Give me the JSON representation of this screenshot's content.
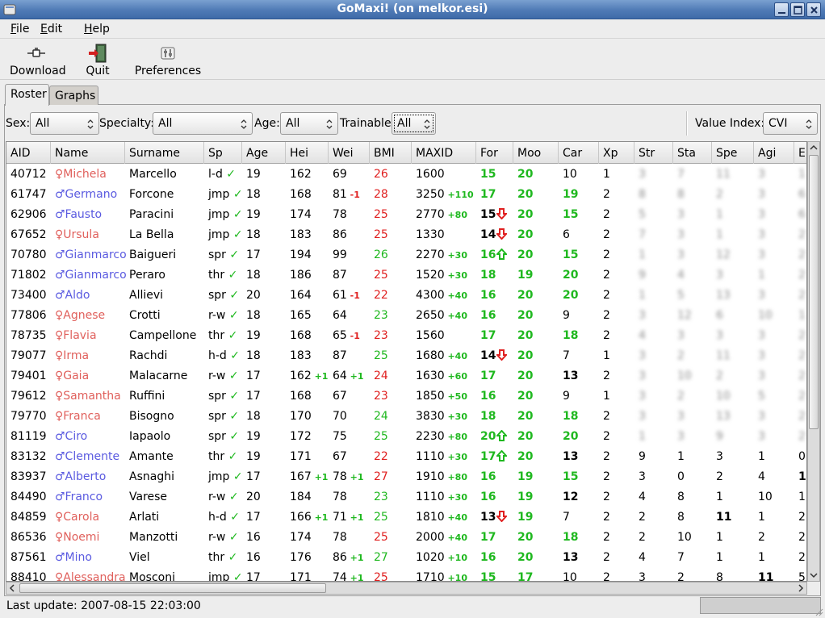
{
  "window": {
    "title": "GoMaxi! (on melkor.esi)"
  },
  "menus": [
    {
      "label": "File",
      "mnemonic": "F",
      "rest": "ile"
    },
    {
      "label": "Edit",
      "mnemonic": "E",
      "rest": "dit"
    },
    {
      "label": "Help",
      "mnemonic": "H",
      "rest": "elp"
    }
  ],
  "toolbar": {
    "download": "Download",
    "quit": "Quit",
    "preferences": "Preferences"
  },
  "tabs": [
    {
      "label": "Roster",
      "active": true
    },
    {
      "label": "Graphs",
      "active": false
    }
  ],
  "filters": {
    "sex": {
      "label": "Sex:",
      "value": "All"
    },
    "specialty": {
      "label": "Specialty:",
      "value": "All"
    },
    "age": {
      "label": "Age:",
      "value": "All"
    },
    "trainable": {
      "label": "Trainable:",
      "value": "All"
    },
    "value_index": {
      "label": "Value Index:",
      "value": "CVI"
    }
  },
  "columns": [
    "AID",
    "Name",
    "Surname",
    "Sp",
    "Age",
    "Hei",
    "Wei",
    "BMI",
    "MAXID",
    "For",
    "Moo",
    "Car",
    "Xp",
    "Str",
    "Sta",
    "Spe",
    "Agi",
    "E"
  ],
  "rows": [
    {
      "aid": "40712",
      "g": "f",
      "name": "Michela",
      "surname": "Marcello",
      "sp": "l-d",
      "age": "19",
      "hei": "162",
      "heid": "",
      "wei": "69",
      "weid": "",
      "bmi": "26",
      "bmic": "red",
      "maxid": "1600",
      "maxd": "",
      "for": "15",
      "fora": "",
      "moo": "20",
      "car": "10",
      "carc": "",
      "xp": "1",
      "str": "3",
      "sta": "7",
      "spe": "11",
      "agi": "3",
      "e": "1",
      "blur": true
    },
    {
      "aid": "61747",
      "g": "m",
      "name": "Germano",
      "surname": "Forcone",
      "sp": "jmp",
      "age": "18",
      "hei": "168",
      "heid": "",
      "wei": "81",
      "weid": "-1",
      "bmi": "28",
      "bmic": "red",
      "maxid": "3250",
      "maxd": "+110",
      "for": "17",
      "fora": "",
      "moo": "20",
      "car": "19",
      "carc": "g",
      "xp": "2",
      "str": "8",
      "sta": "8",
      "spe": "2",
      "agi": "3",
      "e": "6",
      "blur": true
    },
    {
      "aid": "62906",
      "g": "m",
      "name": "Fausto",
      "surname": "Paracini",
      "sp": "jmp",
      "age": "19",
      "hei": "174",
      "heid": "",
      "wei": "78",
      "weid": "",
      "bmi": "25",
      "bmic": "red",
      "maxid": "2770",
      "maxd": "+80",
      "for": "15",
      "fora": "down",
      "moo": "20",
      "car": "15",
      "carc": "g",
      "xp": "2",
      "str": "5",
      "sta": "3",
      "spe": "1",
      "agi": "3",
      "e": "6",
      "blur": true
    },
    {
      "aid": "67652",
      "g": "f",
      "name": "Ursula",
      "surname": "La Bella",
      "sp": "jmp",
      "age": "18",
      "hei": "183",
      "heid": "",
      "wei": "86",
      "weid": "",
      "bmi": "25",
      "bmic": "red",
      "maxid": "1330",
      "maxd": "",
      "for": "14",
      "fora": "down",
      "moo": "20",
      "car": "6",
      "carc": "",
      "xp": "2",
      "str": "7",
      "sta": "3",
      "spe": "1",
      "agi": "3",
      "e": "2",
      "blur": true
    },
    {
      "aid": "70780",
      "g": "m",
      "name": "Gianmarco",
      "surname": "Baigueri",
      "sp": "spr",
      "age": "17",
      "hei": "194",
      "heid": "",
      "wei": "99",
      "weid": "",
      "bmi": "26",
      "bmic": "green",
      "maxid": "2270",
      "maxd": "+30",
      "for": "16",
      "fora": "up",
      "moo": "20",
      "car": "15",
      "carc": "g",
      "xp": "2",
      "str": "1",
      "sta": "3",
      "spe": "12",
      "agi": "3",
      "e": "2",
      "blur": true
    },
    {
      "aid": "71802",
      "g": "m",
      "name": "Gianmarco",
      "surname": "Peraro",
      "sp": "thr",
      "age": "18",
      "hei": "186",
      "heid": "",
      "wei": "87",
      "weid": "",
      "bmi": "25",
      "bmic": "red",
      "maxid": "1520",
      "maxd": "+30",
      "for": "18",
      "fora": "",
      "moo": "19",
      "car": "20",
      "carc": "g",
      "xp": "2",
      "str": "9",
      "sta": "4",
      "spe": "3",
      "agi": "1",
      "e": "2",
      "blur": true
    },
    {
      "aid": "73400",
      "g": "m",
      "name": "Aldo",
      "surname": "Allievi",
      "sp": "spr",
      "age": "20",
      "hei": "164",
      "heid": "",
      "wei": "61",
      "weid": "-1",
      "bmi": "22",
      "bmic": "red",
      "maxid": "4300",
      "maxd": "+40",
      "for": "16",
      "fora": "",
      "moo": "20",
      "car": "20",
      "carc": "g",
      "xp": "2",
      "str": "1",
      "sta": "5",
      "spe": "13",
      "agi": "3",
      "e": "2",
      "blur": true
    },
    {
      "aid": "77806",
      "g": "f",
      "name": "Agnese",
      "surname": "Crotti",
      "sp": "r-w",
      "age": "18",
      "hei": "165",
      "heid": "",
      "wei": "64",
      "weid": "",
      "bmi": "23",
      "bmic": "green",
      "maxid": "2650",
      "maxd": "+40",
      "for": "16",
      "fora": "",
      "moo": "20",
      "car": "9",
      "carc": "",
      "xp": "2",
      "str": "3",
      "sta": "12",
      "spe": "6",
      "agi": "10",
      "e": "1",
      "blur": true
    },
    {
      "aid": "78735",
      "g": "f",
      "name": "Flavia",
      "surname": "Campellone",
      "sp": "thr",
      "age": "19",
      "hei": "168",
      "heid": "",
      "wei": "65",
      "weid": "-1",
      "bmi": "23",
      "bmic": "red",
      "maxid": "1560",
      "maxd": "",
      "for": "17",
      "fora": "",
      "moo": "20",
      "car": "18",
      "carc": "g",
      "xp": "2",
      "str": "4",
      "sta": "3",
      "spe": "3",
      "agi": "3",
      "e": "2",
      "blur": true
    },
    {
      "aid": "79077",
      "g": "f",
      "name": "Irma",
      "surname": "Rachdi",
      "sp": "h-d",
      "age": "18",
      "hei": "183",
      "heid": "",
      "wei": "87",
      "weid": "",
      "bmi": "25",
      "bmic": "green",
      "maxid": "1680",
      "maxd": "+40",
      "for": "14",
      "fora": "down",
      "moo": "20",
      "car": "7",
      "carc": "",
      "xp": "1",
      "str": "3",
      "sta": "2",
      "spe": "11",
      "agi": "3",
      "e": "2",
      "blur": true
    },
    {
      "aid": "79401",
      "g": "f",
      "name": "Gaia",
      "surname": "Malacarne",
      "sp": "r-w",
      "age": "17",
      "hei": "162",
      "heid": "+1",
      "wei": "64",
      "weid": "+1",
      "bmi": "24",
      "bmic": "red",
      "maxid": "1630",
      "maxd": "+60",
      "for": "17",
      "fora": "",
      "moo": "20",
      "car": "13",
      "carc": "b",
      "xp": "2",
      "str": "3",
      "sta": "10",
      "spe": "2",
      "agi": "3",
      "e": "2",
      "blur": true
    },
    {
      "aid": "79612",
      "g": "f",
      "name": "Samantha",
      "surname": "Ruffini",
      "sp": "spr",
      "age": "17",
      "hei": "168",
      "heid": "",
      "wei": "67",
      "weid": "",
      "bmi": "23",
      "bmic": "red",
      "maxid": "1850",
      "maxd": "+50",
      "for": "16",
      "fora": "",
      "moo": "20",
      "car": "9",
      "carc": "",
      "xp": "1",
      "str": "3",
      "sta": "2",
      "spe": "10",
      "agi": "5",
      "e": "2",
      "blur": true
    },
    {
      "aid": "79770",
      "g": "f",
      "name": "Franca",
      "surname": "Bisogno",
      "sp": "spr",
      "age": "18",
      "hei": "170",
      "heid": "",
      "wei": "70",
      "weid": "",
      "bmi": "24",
      "bmic": "green",
      "maxid": "3830",
      "maxd": "+30",
      "for": "18",
      "fora": "",
      "moo": "20",
      "car": "18",
      "carc": "g",
      "xp": "2",
      "str": "3",
      "sta": "3",
      "spe": "13",
      "agi": "3",
      "e": "2",
      "blur": true
    },
    {
      "aid": "81119",
      "g": "m",
      "name": "Ciro",
      "surname": "Iapaolo",
      "sp": "spr",
      "age": "19",
      "hei": "172",
      "heid": "",
      "wei": "75",
      "weid": "",
      "bmi": "25",
      "bmic": "green",
      "maxid": "2230",
      "maxd": "+80",
      "for": "20",
      "fora": "up",
      "moo": "20",
      "car": "20",
      "carc": "g",
      "xp": "2",
      "str": "1",
      "sta": "3",
      "spe": "9",
      "agi": "3",
      "e": "2",
      "blur": true
    },
    {
      "aid": "83132",
      "g": "m",
      "name": "Clemente",
      "surname": "Amante",
      "sp": "thr",
      "age": "19",
      "hei": "171",
      "heid": "",
      "wei": "67",
      "weid": "",
      "bmi": "22",
      "bmic": "red",
      "maxid": "1110",
      "maxd": "+30",
      "for": "17",
      "fora": "up",
      "moo": "20",
      "car": "13",
      "carc": "b",
      "xp": "2",
      "str": "9",
      "sta": "1",
      "spe": "3",
      "agi": "1",
      "e": "0",
      "blur": false
    },
    {
      "aid": "83937",
      "g": "m",
      "name": "Alberto",
      "surname": "Asnaghi",
      "sp": "jmp",
      "age": "17",
      "hei": "167",
      "heid": "+1",
      "wei": "78",
      "weid": "+1",
      "bmi": "27",
      "bmic": "red",
      "maxid": "1910",
      "maxd": "+80",
      "for": "16",
      "fora": "",
      "moo": "19",
      "car": "15",
      "carc": "g",
      "xp": "2",
      "str": "3",
      "sta": "0",
      "spe": "2",
      "agi": "4",
      "e": "1",
      "eb": true,
      "blur": false
    },
    {
      "aid": "84490",
      "g": "m",
      "name": "Franco",
      "surname": "Varese",
      "sp": "r-w",
      "age": "20",
      "hei": "184",
      "heid": "",
      "wei": "78",
      "weid": "",
      "bmi": "23",
      "bmic": "green",
      "maxid": "1110",
      "maxd": "+30",
      "for": "16",
      "fora": "",
      "moo": "19",
      "car": "12",
      "carc": "b",
      "xp": "2",
      "str": "4",
      "sta": "8",
      "spe": "1",
      "agi": "10",
      "e": "1",
      "blur": false
    },
    {
      "aid": "84859",
      "g": "f",
      "name": "Carola",
      "surname": "Arlati",
      "sp": "h-d",
      "age": "17",
      "hei": "166",
      "heid": "+1",
      "wei": "71",
      "weid": "+1",
      "bmi": "25",
      "bmic": "green",
      "maxid": "1810",
      "maxd": "+40",
      "for": "13",
      "fora": "down",
      "moo": "19",
      "car": "7",
      "carc": "",
      "xp": "2",
      "str": "2",
      "sta": "8",
      "spe": "11",
      "speb": true,
      "agi": "1",
      "e": "2",
      "blur": false
    },
    {
      "aid": "86536",
      "g": "f",
      "name": "Noemi",
      "surname": "Manzotti",
      "sp": "r-w",
      "age": "16",
      "hei": "174",
      "heid": "",
      "wei": "78",
      "weid": "",
      "bmi": "25",
      "bmic": "red",
      "maxid": "2000",
      "maxd": "+40",
      "for": "17",
      "fora": "",
      "moo": "20",
      "car": "18",
      "carc": "g",
      "xp": "2",
      "str": "2",
      "sta": "10",
      "spe": "1",
      "agi": "2",
      "e": "2",
      "blur": false
    },
    {
      "aid": "87561",
      "g": "m",
      "name": "Mino",
      "surname": "Viel",
      "sp": "thr",
      "age": "16",
      "hei": "176",
      "heid": "",
      "wei": "86",
      "weid": "+1",
      "bmi": "27",
      "bmic": "green",
      "maxid": "1020",
      "maxd": "+10",
      "for": "16",
      "fora": "",
      "moo": "20",
      "car": "13",
      "carc": "b",
      "xp": "2",
      "str": "4",
      "sta": "7",
      "spe": "1",
      "agi": "1",
      "e": "2",
      "blur": false
    },
    {
      "aid": "88410",
      "g": "f",
      "name": "Alessandra",
      "surname": "Mosconi",
      "sp": "jmp",
      "age": "17",
      "hei": "171",
      "heid": "",
      "wei": "74",
      "weid": "+1",
      "bmi": "25",
      "bmic": "red",
      "maxid": "1710",
      "maxd": "+10",
      "for": "15",
      "fora": "",
      "moo": "17",
      "car": "10",
      "carc": "",
      "xp": "2",
      "str": "3",
      "sta": "2",
      "spe": "8",
      "agi": "11",
      "agib": true,
      "e": "5",
      "blur": false
    }
  ],
  "status": {
    "text": "Last update: 2007-08-15 22:03:00"
  }
}
